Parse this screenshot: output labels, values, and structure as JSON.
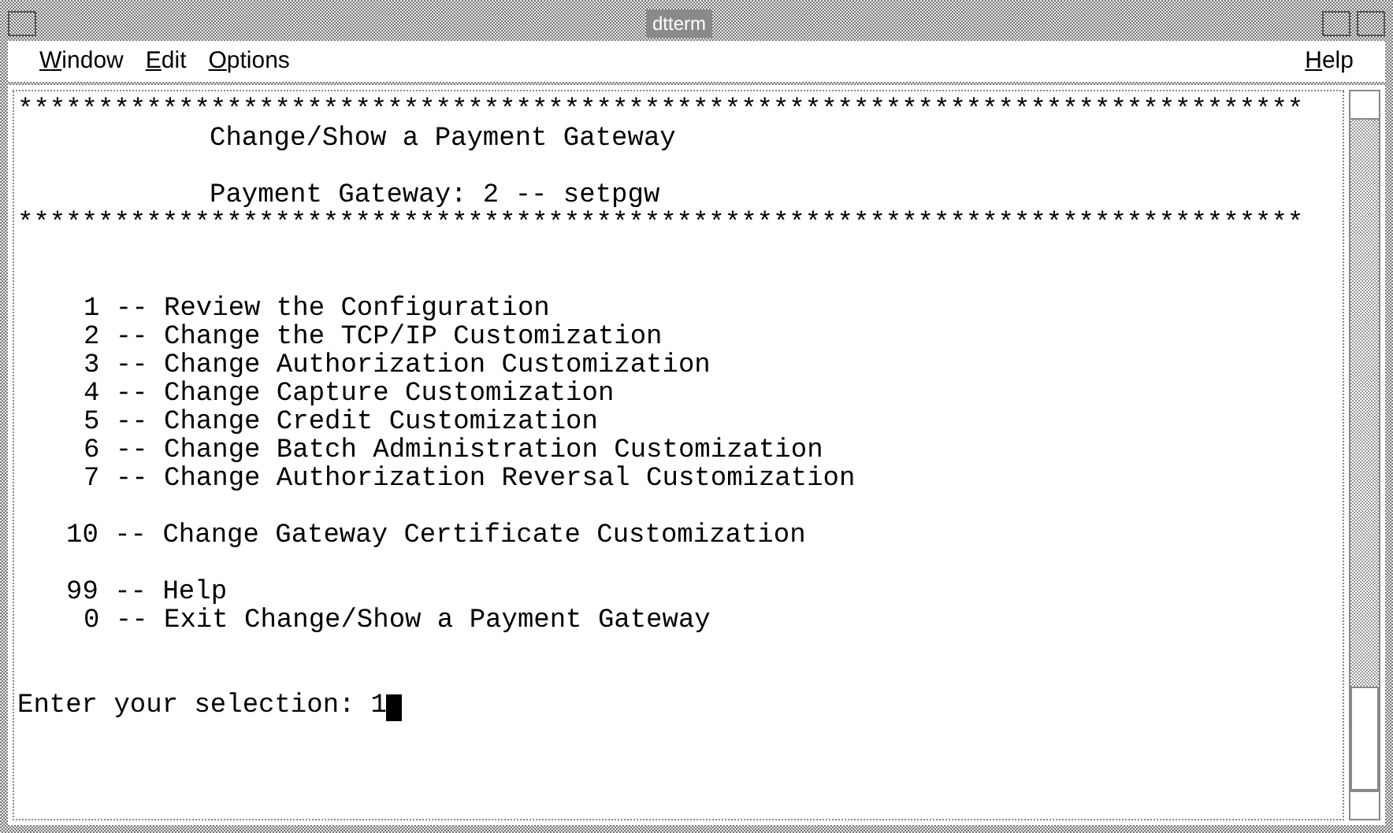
{
  "window": {
    "title": "dtterm"
  },
  "menu": [
    {
      "label": "Window"
    },
    {
      "label": "Edit"
    },
    {
      "label": "Options"
    },
    {
      "label": "Help"
    }
  ],
  "terminal": {
    "lines": [
      {
        "kind": "rule",
        "text": "********************************************************************************"
      },
      {
        "kind": "heading",
        "text": "Change/Show a Payment Gateway"
      },
      {
        "kind": "blank"
      },
      {
        "kind": "heading",
        "text": "Payment Gateway: 2 -- setpgw"
      },
      {
        "kind": "rule",
        "text": "********************************************************************************"
      },
      {
        "kind": "blank"
      },
      {
        "kind": "blank"
      },
      {
        "kind": "option",
        "text": "1 -- Review the Configuration"
      },
      {
        "kind": "option",
        "text": "2 -- Change the TCP/IP Customization"
      },
      {
        "kind": "option",
        "text": "3 -- Change Authorization Customization"
      },
      {
        "kind": "option",
        "text": "4 -- Change Capture Customization"
      },
      {
        "kind": "option",
        "text": "5 -- Change Credit Customization"
      },
      {
        "kind": "option",
        "text": "6 -- Change Batch Administration Customization"
      },
      {
        "kind": "option",
        "text": "7 -- Change Authorization Reversal Customization"
      },
      {
        "kind": "blank"
      },
      {
        "kind": "wide",
        "text": "10 -- Change Gateway Certificate Customization"
      },
      {
        "kind": "blank"
      },
      {
        "kind": "wide",
        "text": "99 -- Help"
      },
      {
        "kind": "option",
        "text": "0 -- Exit Change/Show a Payment Gateway"
      },
      {
        "kind": "blank"
      },
      {
        "kind": "blank"
      }
    ],
    "prompt": {
      "label": "Enter your selection:",
      "value": "1"
    }
  }
}
